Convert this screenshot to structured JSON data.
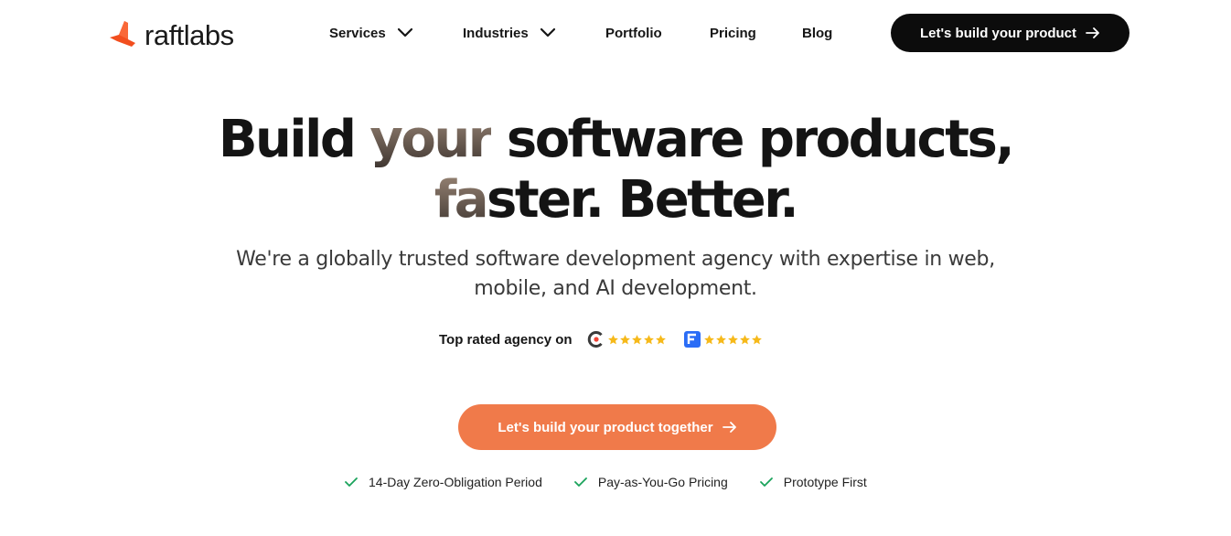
{
  "brand": {
    "name": "raftlabs",
    "accent": "#f24e1e"
  },
  "nav": {
    "items": [
      {
        "label": "Services",
        "has_dropdown": true
      },
      {
        "label": "Industries",
        "has_dropdown": true
      },
      {
        "label": "Portfolio",
        "has_dropdown": false
      },
      {
        "label": "Pricing",
        "has_dropdown": false
      },
      {
        "label": "Blog",
        "has_dropdown": false
      }
    ],
    "cta_label": "Let's build your product"
  },
  "hero": {
    "title_part1": "Build ",
    "title_highlight": "your",
    "title_part2": " software products,",
    "title_line2_highlight": "fa",
    "title_line2": "ster. Better.",
    "subtitle_line1": "We're a globally trusted software development agency with expertise in web,",
    "subtitle_line2": "mobile, and AI development."
  },
  "rating": {
    "label": "Top rated agency on",
    "platforms": [
      {
        "icon": "clutch-icon",
        "stars": 5,
        "color": "#ef4335"
      },
      {
        "icon": "goodfirms-icon",
        "stars": 5,
        "color": "#2a6cf6"
      }
    ],
    "star_color": "#f6b91a"
  },
  "cta": {
    "label": "Let's build your product together",
    "color": "#f07a4a"
  },
  "features": [
    {
      "label": "14-Day Zero-Obligation Period"
    },
    {
      "label": "Pay-as-You-Go Pricing"
    },
    {
      "label": "Prototype First"
    }
  ],
  "check_color": "#1aa35b"
}
